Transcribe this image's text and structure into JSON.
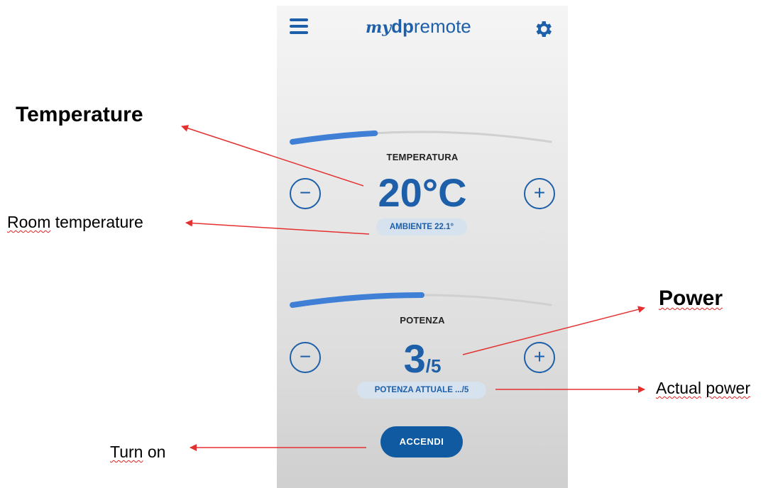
{
  "app": {
    "logo": {
      "my": "my",
      "dp": "dp",
      "remote": "remote"
    },
    "accent_color": "#1d5fa8",
    "track_color": "#d0d0d0"
  },
  "header": {
    "menu_icon": "hamburger-icon",
    "settings_icon": "gear-icon"
  },
  "temperature": {
    "label": "TEMPERATURA",
    "value": "20°C",
    "ambient": "AMBIENTE 22.1°",
    "level_fraction": 0.32,
    "decrement_label": "−",
    "increment_label": "+"
  },
  "power": {
    "label": "POTENZA",
    "value": "3",
    "max": "/5",
    "actual": "POTENZA ATTUALE .../5",
    "level_fraction": 0.5,
    "decrement_label": "−",
    "increment_label": "+"
  },
  "actions": {
    "turn_on_label": "ACCENDI"
  },
  "annotations": {
    "temperature": "Temperature",
    "room_temperature_1": "Room",
    "room_temperature_2": "temperature",
    "power": "Power",
    "actual_power_1": "Actual",
    "actual_power_2": "power",
    "turn_on_1": "Turn",
    "turn_on_2": "on",
    "arrow_color": "#e53030"
  }
}
